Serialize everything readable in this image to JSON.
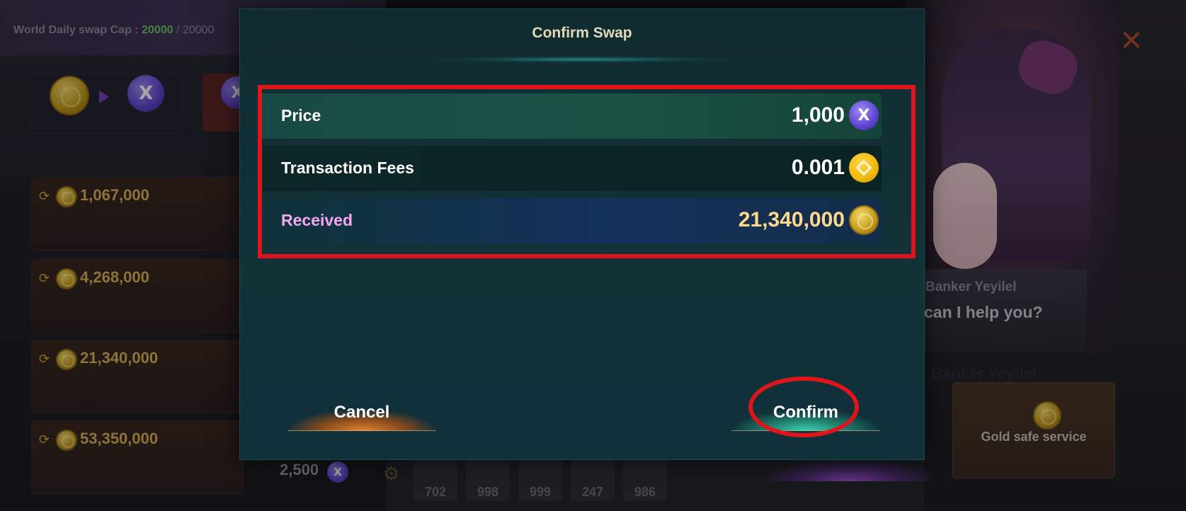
{
  "background": {
    "cap": {
      "label": "World Daily swap Cap :",
      "current": "20000",
      "separator": "/",
      "max": "20000"
    },
    "packages": [
      {
        "amount": "1,067,000"
      },
      {
        "amount": "4,268,000"
      },
      {
        "amount": "21,340,000"
      },
      {
        "amount": "53,350,000"
      }
    ],
    "bottom_price": "2,500",
    "slots": [
      "702",
      "998",
      "999",
      "247",
      "986"
    ],
    "banker": {
      "name": "Banker Yeyilel",
      "question": "can I help you?",
      "faded_name": "Banker Yeyilel"
    },
    "gold_safe_label": "Gold safe service",
    "close_glyph": "✕"
  },
  "dialog": {
    "title": "Confirm Swap",
    "rows": [
      {
        "label": "Price",
        "value": "1,000",
        "icon": "x-token-icon"
      },
      {
        "label": "Transaction Fees",
        "value": "0.001",
        "icon": "bnb-icon"
      },
      {
        "label": "Received",
        "value": "21,340,000",
        "icon": "gold-coin-icon"
      }
    ],
    "cancel_label": "Cancel",
    "confirm_label": "Confirm"
  },
  "colors": {
    "highlight": "#e0141b",
    "received_label": "#f2a6f0",
    "received_value": "#ffd98a",
    "cap_current": "#6fc46a",
    "dialog_bg": "#123238"
  }
}
